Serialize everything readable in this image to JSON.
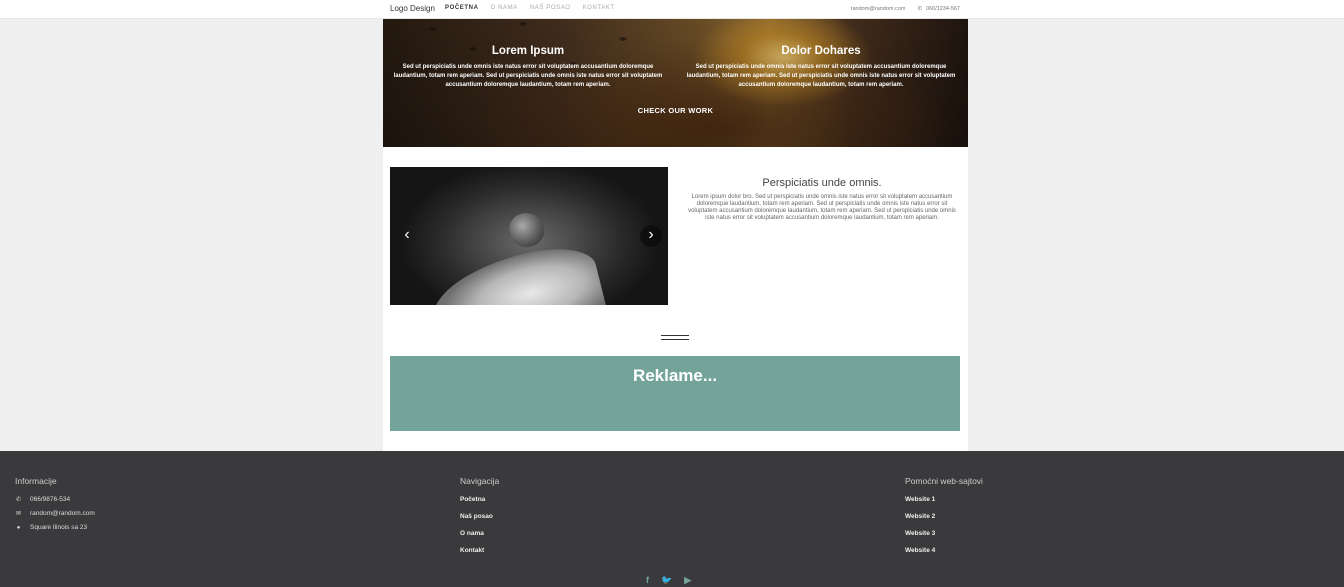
{
  "header": {
    "logo": "Logo Design",
    "nav": [
      {
        "label": "POČETNA",
        "active": true
      },
      {
        "label": "O NAMA",
        "active": false
      },
      {
        "label": "NAŠ POSAO",
        "active": false
      },
      {
        "label": "KONTAKT",
        "active": false
      }
    ],
    "email": "random@random.com",
    "phone": "060/1234-567"
  },
  "hero": {
    "col1_title": "Lorem Ipsum",
    "col1_text": "Sed ut perspiciatis unde omnis iste natus error sit voluptatem accusantium doloremque laudantium, totam rem aperiam. Sed ut perspiciatis unde omnis iste natus error sit voluptatem accusantium doloremque laudantium, totam rem aperiam.",
    "col2_title": "Dolor Dohares",
    "col2_text": "Sed ut perspiciatis unde omnis iste natus error sit voluptatem accusantium doloremque laudantium, totam rem aperiam. Sed ut perspiciatis unde omnis iste natus error sit voluptatem accusantium doloremque laudantium, totam rem aperiam.",
    "cta": "CHECK OUR WORK"
  },
  "slider": {
    "prev_icon": "‹",
    "next_icon": "›"
  },
  "feature": {
    "title": "Perspiciatis unde omnis.",
    "text": "Lorem ipsum dolor bro. Sed ut perspiciatis unde omnis iste natus error sit voluptatem accusantium doloremque laudantium, totam rem aperiam. Sed ut perspiciatis unde omnis iste natus error sit voluptatem accusantium doloremque laudantium, totam rem aperiam. Sed ut perspiciatis unde omnis iste natus error sit voluptatem accusantium doloremque laudantium, totam rem aperiam."
  },
  "ads": {
    "title": "Reklame..."
  },
  "footer": {
    "info_title": "Informacije",
    "phone": "066/9876-534",
    "email": "random@random.com",
    "address": "Square Ilinois sa 23",
    "nav_title": "Navigacija",
    "nav_links": [
      "Početna",
      "Naš posao",
      "O nama",
      "Kontakt"
    ],
    "sites_title": "Pomoćni web-sajtovi",
    "sites": [
      "Website 1",
      "Website 2",
      "Website 3",
      "Website 4"
    ],
    "social": [
      "f",
      "t",
      "yt"
    ]
  },
  "colors": {
    "accent": "#74a39a",
    "footer_bg": "#3a3a3c"
  }
}
